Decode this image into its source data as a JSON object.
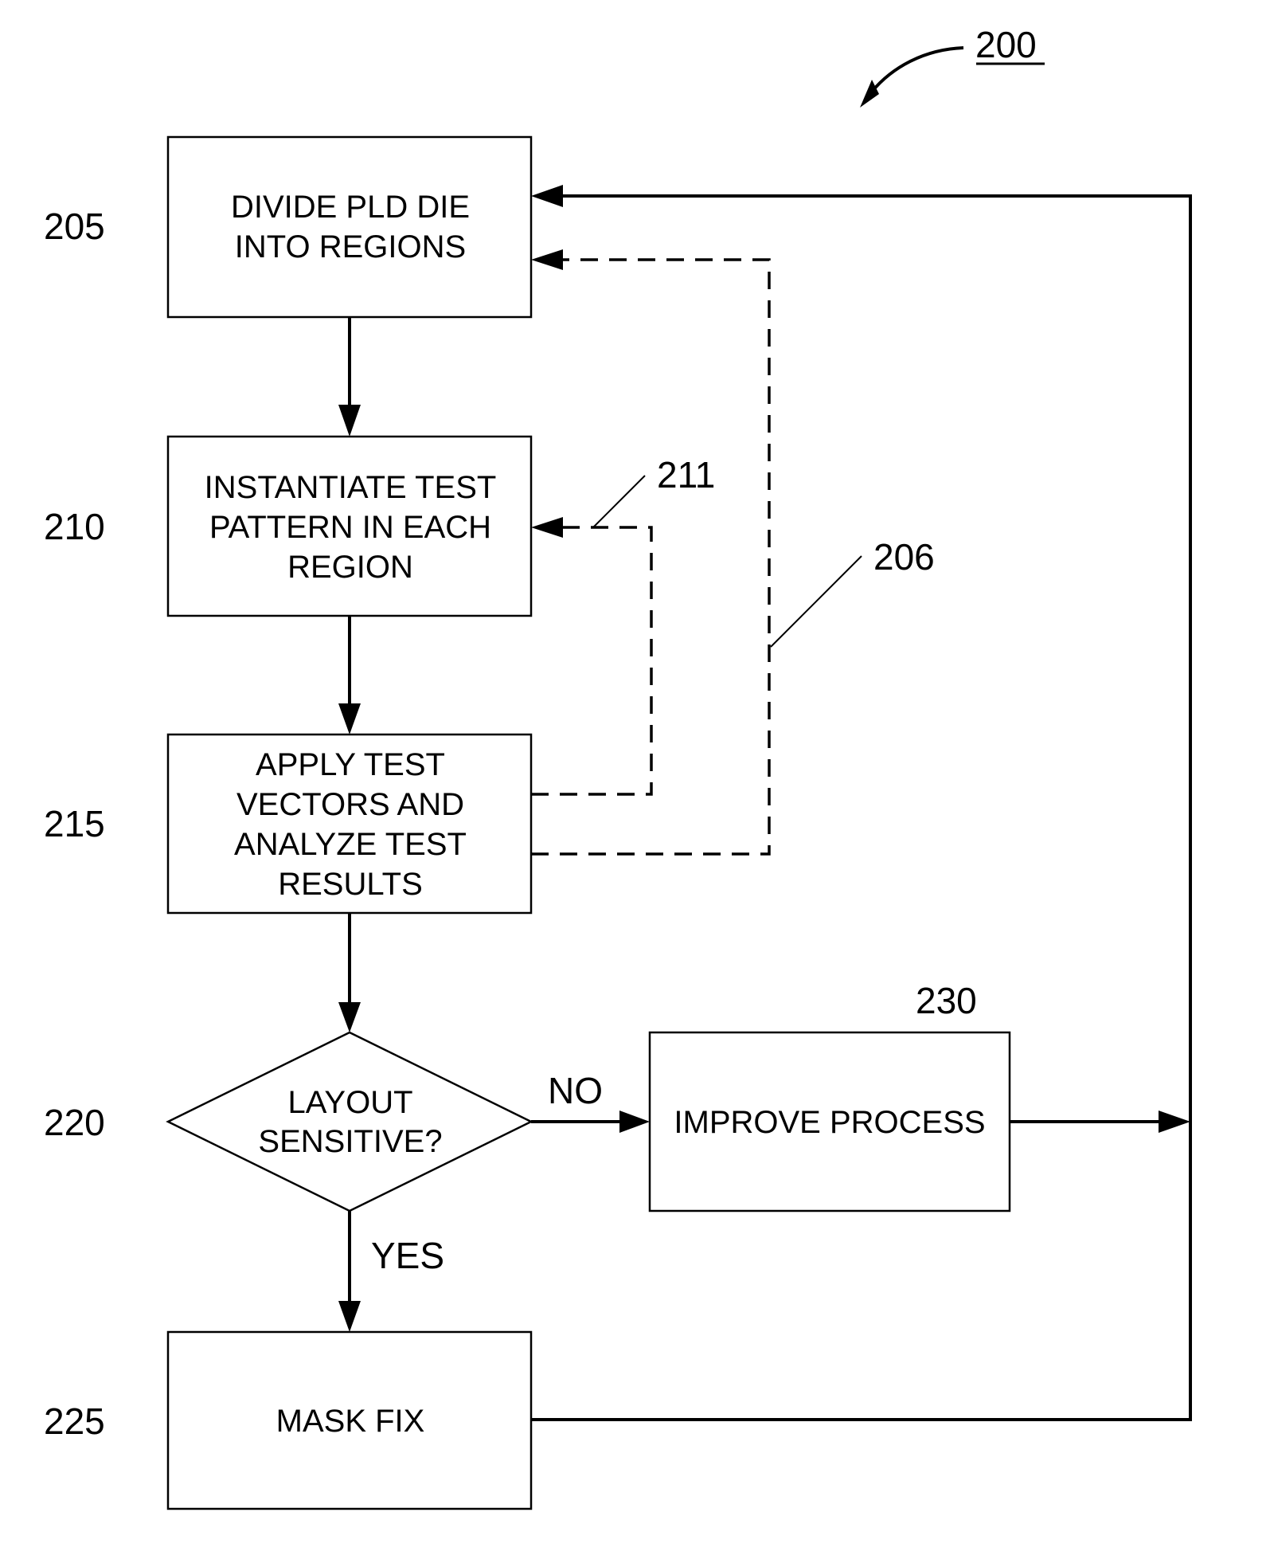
{
  "figure": {
    "number": "200"
  },
  "steps": [
    {
      "ref": "205",
      "lines": [
        "DIVIDE PLD DIE",
        "INTO REGIONS"
      ]
    },
    {
      "ref": "210",
      "lines": [
        "INSTANTIATE TEST",
        "PATTERN IN EACH",
        "REGION"
      ]
    },
    {
      "ref": "215",
      "lines": [
        "APPLY TEST",
        "VECTORS AND",
        "ANALYZE TEST",
        "RESULTS"
      ]
    },
    {
      "ref": "220",
      "lines": [
        "LAYOUT",
        "SENSITIVE?"
      ]
    },
    {
      "ref": "225",
      "lines": [
        "MASK FIX"
      ]
    },
    {
      "ref": "230",
      "lines": [
        "IMPROVE PROCESS"
      ]
    }
  ],
  "branches": {
    "no_label": "NO",
    "yes_label": "YES"
  },
  "feedback_paths": [
    {
      "ref": "211"
    },
    {
      "ref": "206"
    }
  ]
}
